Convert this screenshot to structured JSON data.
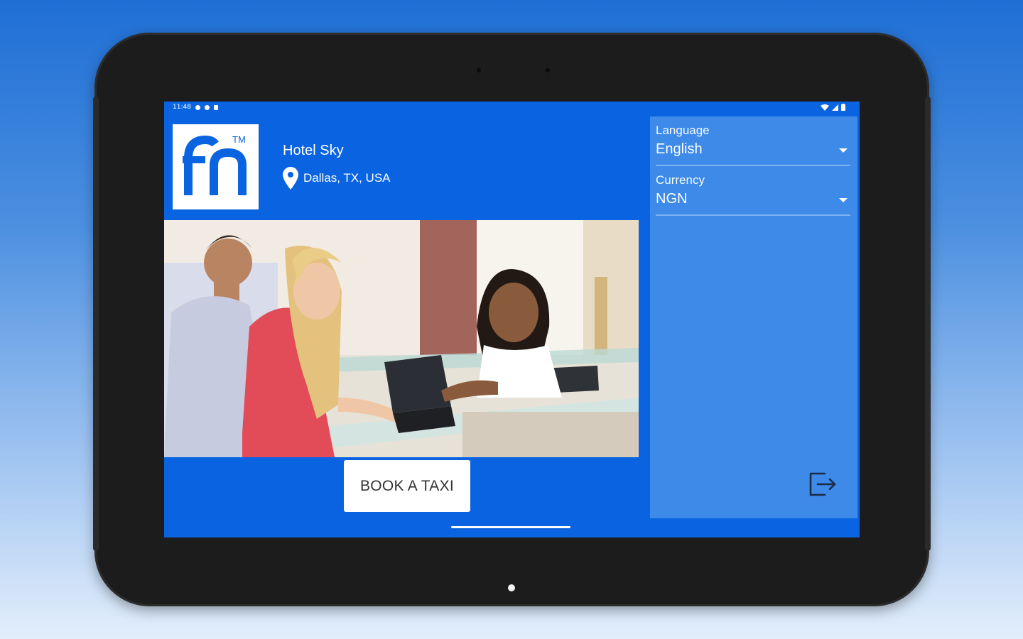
{
  "statusbar": {
    "time": "11:48"
  },
  "hotel": {
    "name": "Hotel Sky",
    "location": "Dallas, TX, USA"
  },
  "logo": {
    "letters": "fn",
    "trademark": "TM"
  },
  "actions": {
    "book_taxi": "BOOK A TAXI"
  },
  "settings": {
    "language": {
      "label": "Language",
      "value": "English"
    },
    "currency": {
      "label": "Currency",
      "value": "NGN"
    }
  },
  "icons": [
    "location-pin-icon",
    "chevron-down-icon",
    "logout-icon",
    "wifi-icon",
    "battery-icon"
  ],
  "colors": {
    "primary": "#0a63e0",
    "panel": "#3d8ae9",
    "button_text": "#333333"
  }
}
